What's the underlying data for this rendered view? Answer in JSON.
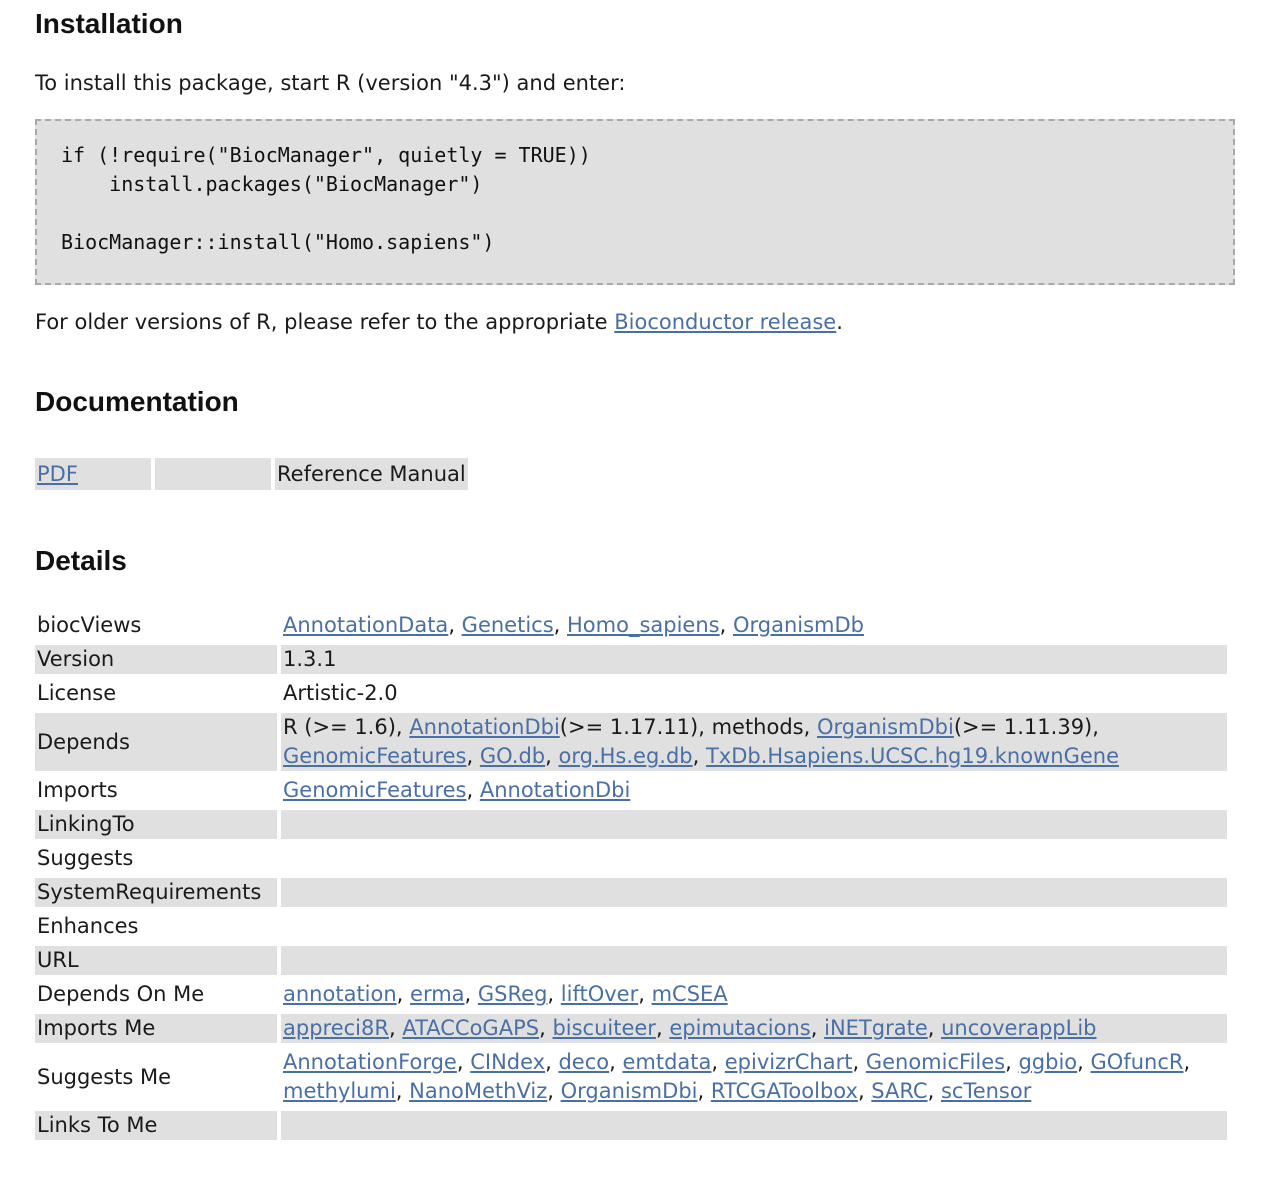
{
  "installation": {
    "heading": "Installation",
    "intro": "To install this package, start R (version \"4.3\") and enter:",
    "code_lines": [
      "if (!require(\"BiocManager\", quietly = TRUE))",
      "    install.packages(\"BiocManager\")",
      "",
      "BiocManager::install(\"Homo.sapiens\")"
    ],
    "older_prefix": "For older versions of R, please refer to the appropriate ",
    "older_link": "Bioconductor release",
    "older_suffix": "."
  },
  "documentation": {
    "heading": "Documentation",
    "rows": [
      {
        "format": "PDF",
        "script": "",
        "title": "Reference Manual"
      }
    ]
  },
  "details": {
    "heading": "Details",
    "rows": [
      {
        "key": "biocViews",
        "items": [
          {
            "text": "AnnotationData",
            "link": true
          },
          {
            "text": "Genetics",
            "link": true
          },
          {
            "text": "Homo_sapiens",
            "link": true
          },
          {
            "text": "OrganismDb",
            "link": true
          }
        ]
      },
      {
        "key": "Version",
        "items": [
          {
            "text": "1.3.1",
            "link": false
          }
        ]
      },
      {
        "key": "License",
        "items": [
          {
            "text": "Artistic-2.0",
            "link": false
          }
        ]
      },
      {
        "key": "Depends",
        "items": [
          {
            "text": "R (>= 1.6)",
            "link": false
          },
          {
            "text": "AnnotationDbi",
            "link": true,
            "suffix": "(>= 1.17.11)"
          },
          {
            "text": "methods",
            "link": false
          },
          {
            "text": "OrganismDbi",
            "link": true,
            "suffix": "(>= 1.11.39)"
          },
          {
            "text": "GenomicFeatures",
            "link": true
          },
          {
            "text": "GO.db",
            "link": true
          },
          {
            "text": "org.Hs.eg.db",
            "link": true
          },
          {
            "text": "TxDb.Hsapiens.UCSC.hg19.knownGene",
            "link": true
          }
        ]
      },
      {
        "key": "Imports",
        "items": [
          {
            "text": "GenomicFeatures",
            "link": true
          },
          {
            "text": "AnnotationDbi",
            "link": true
          }
        ]
      },
      {
        "key": "LinkingTo",
        "items": []
      },
      {
        "key": "Suggests",
        "items": []
      },
      {
        "key": "SystemRequirements",
        "items": []
      },
      {
        "key": "Enhances",
        "items": []
      },
      {
        "key": "URL",
        "items": []
      },
      {
        "key": "Depends On Me",
        "items": [
          {
            "text": "annotation",
            "link": true
          },
          {
            "text": "erma",
            "link": true
          },
          {
            "text": "GSReg",
            "link": true
          },
          {
            "text": "liftOver",
            "link": true
          },
          {
            "text": "mCSEA",
            "link": true
          }
        ]
      },
      {
        "key": "Imports Me",
        "items": [
          {
            "text": "appreci8R",
            "link": true
          },
          {
            "text": "ATACCoGAPS",
            "link": true
          },
          {
            "text": "biscuiteer",
            "link": true
          },
          {
            "text": "epimutacions",
            "link": true
          },
          {
            "text": "iNETgrate",
            "link": true
          },
          {
            "text": "uncoverappLib",
            "link": true
          }
        ]
      },
      {
        "key": "Suggests Me",
        "items": [
          {
            "text": "AnnotationForge",
            "link": true
          },
          {
            "text": "CINdex",
            "link": true
          },
          {
            "text": "deco",
            "link": true
          },
          {
            "text": "emtdata",
            "link": true
          },
          {
            "text": "epivizrChart",
            "link": true
          },
          {
            "text": "GenomicFiles",
            "link": true
          },
          {
            "text": "ggbio",
            "link": true
          },
          {
            "text": "GOfuncR",
            "link": true
          },
          {
            "text": "methylumi",
            "link": true
          },
          {
            "text": "NanoMethViz",
            "link": true
          },
          {
            "text": "OrganismDbi",
            "link": true
          },
          {
            "text": "RTCGAToolbox",
            "link": true
          },
          {
            "text": "SARC",
            "link": true
          },
          {
            "text": "scTensor",
            "link": true
          }
        ]
      },
      {
        "key": "Links To Me",
        "items": []
      }
    ]
  }
}
